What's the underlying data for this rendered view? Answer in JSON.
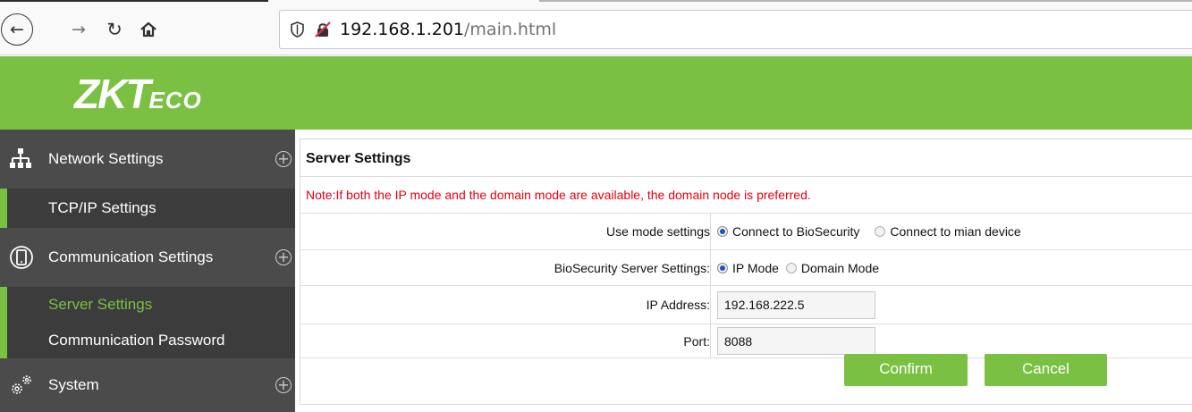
{
  "browser": {
    "url_host": "192.168.1.201",
    "url_path": "/main.html"
  },
  "header": {
    "logo_big": "ZKT",
    "logo_small": "ECO"
  },
  "sidebar": {
    "sections": [
      {
        "label": "Network Settings",
        "icon": "network-icon"
      },
      {
        "label": "Communication Settings",
        "icon": "communication-icon"
      },
      {
        "label": "System",
        "icon": "gears-icon"
      }
    ],
    "items": [
      {
        "label": "TCP/IP Settings",
        "active": false
      },
      {
        "label": "Server Settings",
        "active": true
      },
      {
        "label": "Communication Password",
        "active": false
      }
    ]
  },
  "main": {
    "title": "Server Settings",
    "note": "Note:If both the IP mode and the domain mode are available, the domain node is preferred.",
    "use_mode": {
      "label": "Use mode settings",
      "options": [
        "Connect to BioSecurity",
        "Connect to mian device"
      ],
      "selected": "Connect to BioSecurity"
    },
    "server_settings": {
      "label": "BioSecurity Server Settings:",
      "options": [
        "IP Mode",
        "Domain Mode"
      ],
      "selected": "IP Mode"
    },
    "ip_address": {
      "label": "IP Address:",
      "value": "192.168.222.5"
    },
    "port": {
      "label": "Port:",
      "value": "8088"
    },
    "confirm_label": "Confirm",
    "cancel_label": "Cancel"
  },
  "colors": {
    "brand_green": "#7ac143",
    "sidebar_bg": "#3c3c3c",
    "note_red": "#e60012"
  }
}
